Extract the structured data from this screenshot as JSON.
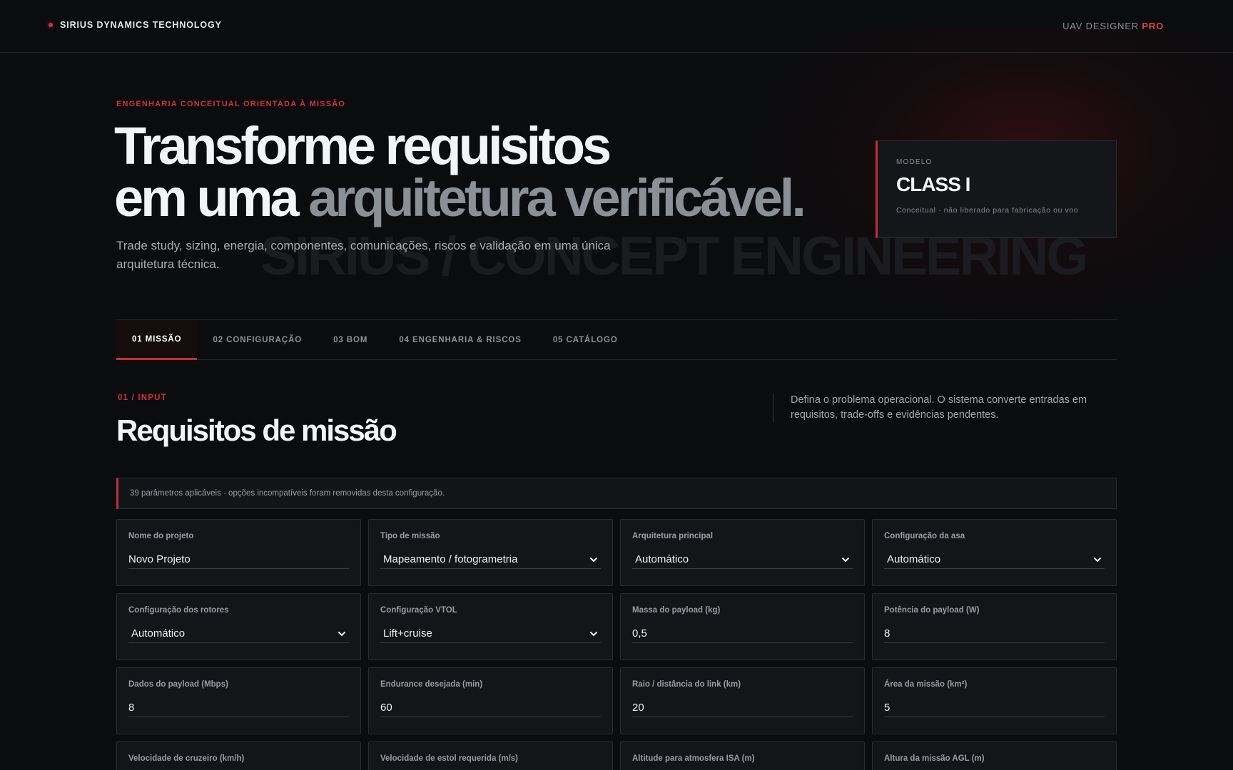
{
  "header": {
    "brand": "SIRIUS DYNAMICS TECHNOLOGY",
    "product_prefix": "UAV DESIGNER",
    "product_suffix": "PRO"
  },
  "hero": {
    "eyebrow": "ENGENHARIA CONCEITUAL ORIENTADA À MISSÃO",
    "headline_line1": "Transforme requisitos",
    "headline_line2_a": "em uma",
    "headline_line2_b": "arquitetura verificável.",
    "subtitle": "Trade study, sizing, energia, componentes, comunicações, riscos e validação em uma única arquitetura técnica.",
    "watermark": "SIRIUS / CONCEPT ENGINEERING"
  },
  "model_card": {
    "label": "MODELO",
    "value": "CLASS I",
    "note": "Conceitual · não liberado para fabricação ou voo"
  },
  "tabs": [
    {
      "label": "01 MISSÃO",
      "active": true
    },
    {
      "label": "02 CONFIGURAÇÃO",
      "active": false
    },
    {
      "label": "03 BOM",
      "active": false
    },
    {
      "label": "04 ENGENHARIA & RISCOS",
      "active": false
    },
    {
      "label": "05 CATÁLOGO",
      "active": false
    }
  ],
  "section": {
    "eyebrow": "01 / INPUT",
    "title": "Requisitos de missão",
    "description": "Defina o problema operacional. O sistema converte entradas em requisitos, trade-offs e evidências pendentes."
  },
  "notice": "39 parâmetros aplicáveis · opções incompatíveis foram removidas desta configuração.",
  "fields": [
    {
      "label": "Nome do projeto",
      "value": "Novo Projeto",
      "kind": "input"
    },
    {
      "label": "Tipo de missão",
      "value": "Mapeamento / fotogrametria",
      "kind": "select"
    },
    {
      "label": "Arquitetura principal",
      "value": "Automático",
      "kind": "select"
    },
    {
      "label": "Configuração da asa",
      "value": "Automático",
      "kind": "select"
    },
    {
      "label": "Configuração dos rotores",
      "value": "Automático",
      "kind": "select"
    },
    {
      "label": "Configuração VTOL",
      "value": "Lift+cruise",
      "kind": "select"
    },
    {
      "label": "Massa do payload (kg)",
      "value": "0,5",
      "kind": "input"
    },
    {
      "label": "Potência do payload (W)",
      "value": "8",
      "kind": "input"
    },
    {
      "label": "Dados do payload (Mbps)",
      "value": "8",
      "kind": "input"
    },
    {
      "label": "Endurance desejada (min)",
      "value": "60",
      "kind": "input"
    },
    {
      "label": "Raio / distância do link (km)",
      "value": "20",
      "kind": "input"
    },
    {
      "label": "Área da missão (km²)",
      "value": "5",
      "kind": "input"
    },
    {
      "label": "Velocidade de cruzeiro (km/h)",
      "value": "",
      "kind": "input"
    },
    {
      "label": "Velocidade de estol requerida (m/s)",
      "value": "",
      "kind": "input"
    },
    {
      "label": "Altitude para atmosfera ISA (m)",
      "value": "",
      "kind": "input"
    },
    {
      "label": "Altura da missão AGL (m)",
      "value": "",
      "kind": "input"
    }
  ],
  "colors": {
    "accent": "#c12f39",
    "background": "#0b0c0e",
    "card": "#131518"
  },
  "icons": {
    "select_chevron": "chevron-down-icon",
    "brand_mark": "status-dot-icon"
  }
}
